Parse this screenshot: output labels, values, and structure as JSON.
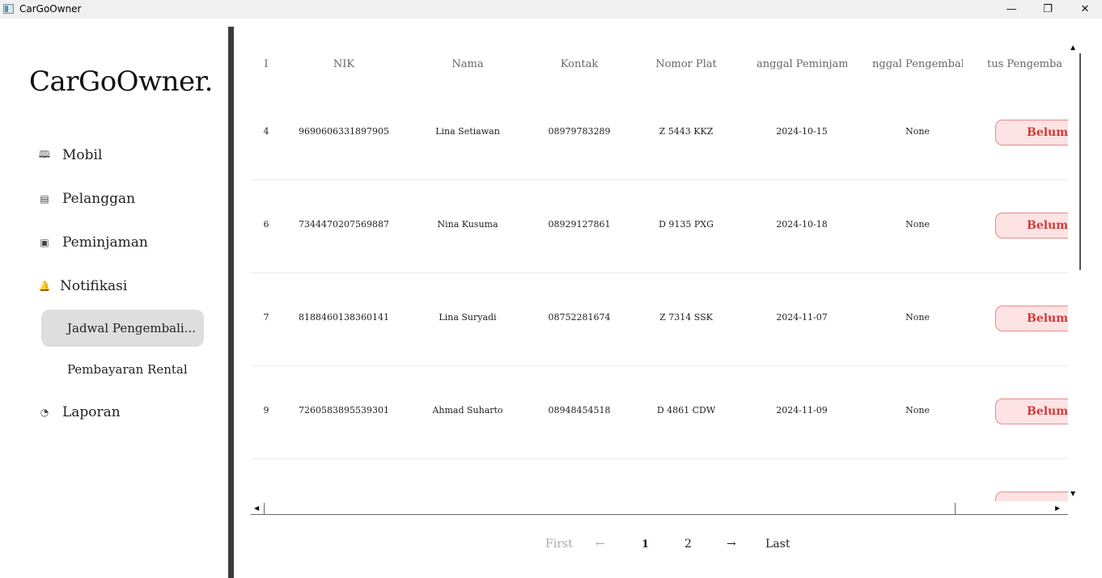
{
  "window": {
    "title": "CarGoOwner",
    "controls": {
      "minimize": "—",
      "maximize": "❐",
      "close": "✕"
    }
  },
  "sidebar": {
    "brand": "CarGoOwner.",
    "items": [
      {
        "label": "Mobil",
        "icon": "book-icon",
        "glyph": "🕮"
      },
      {
        "label": "Pelanggan",
        "icon": "id-card-icon",
        "glyph": "▤"
      },
      {
        "label": "Peminjaman",
        "icon": "document-icon",
        "glyph": "▣"
      },
      {
        "label": "Notifikasi",
        "icon": "bell-icon",
        "glyph": "🔔"
      },
      {
        "label": "Laporan",
        "icon": "pie-chart-icon",
        "glyph": "◔"
      }
    ],
    "subitems": [
      {
        "label": "Jadwal Pengembali...",
        "active": true
      },
      {
        "label": "Pembayaran Rental",
        "active": false
      }
    ]
  },
  "table": {
    "headers": [
      "I",
      "NIK",
      "Nama",
      "Kontak",
      "Nomor Plat",
      "anggal Peminjama",
      "nggal Pengembali",
      "tus Pengembal"
    ],
    "rows": [
      {
        "id": "4",
        "nik": "9690606331897905",
        "nama": "Lina Setiawan",
        "kontak": "08979783289",
        "plat": "Z 5443 KKZ",
        "tgl_pinjam": "2024-10-15",
        "tgl_kembali": "None",
        "status": "Belum"
      },
      {
        "id": "6",
        "nik": "7344470207569887",
        "nama": "Nina Kusuma",
        "kontak": "08929127861",
        "plat": "D 9135 PXG",
        "tgl_pinjam": "2024-10-18",
        "tgl_kembali": "None",
        "status": "Belum"
      },
      {
        "id": "7",
        "nik": "8188460138360141",
        "nama": "Lina Suryadi",
        "kontak": "08752281674",
        "plat": "Z 7314 SSK",
        "tgl_pinjam": "2024-11-07",
        "tgl_kembali": "None",
        "status": "Belum"
      },
      {
        "id": "9",
        "nik": "7260583895539301",
        "nama": "Ahmad Suharto",
        "kontak": "08948454518",
        "plat": "D 4861 CDW",
        "tgl_pinjam": "2024-11-09",
        "tgl_kembali": "None",
        "status": "Belum"
      }
    ],
    "status_color": "#d23a3a"
  },
  "scrollbars": {
    "up": "▲",
    "down": "▼",
    "left": "◀",
    "right": "▶"
  },
  "pagination": {
    "first": "First",
    "prev": "←",
    "pages": [
      "1",
      "2"
    ],
    "current": "1",
    "next": "→",
    "last": "Last"
  }
}
